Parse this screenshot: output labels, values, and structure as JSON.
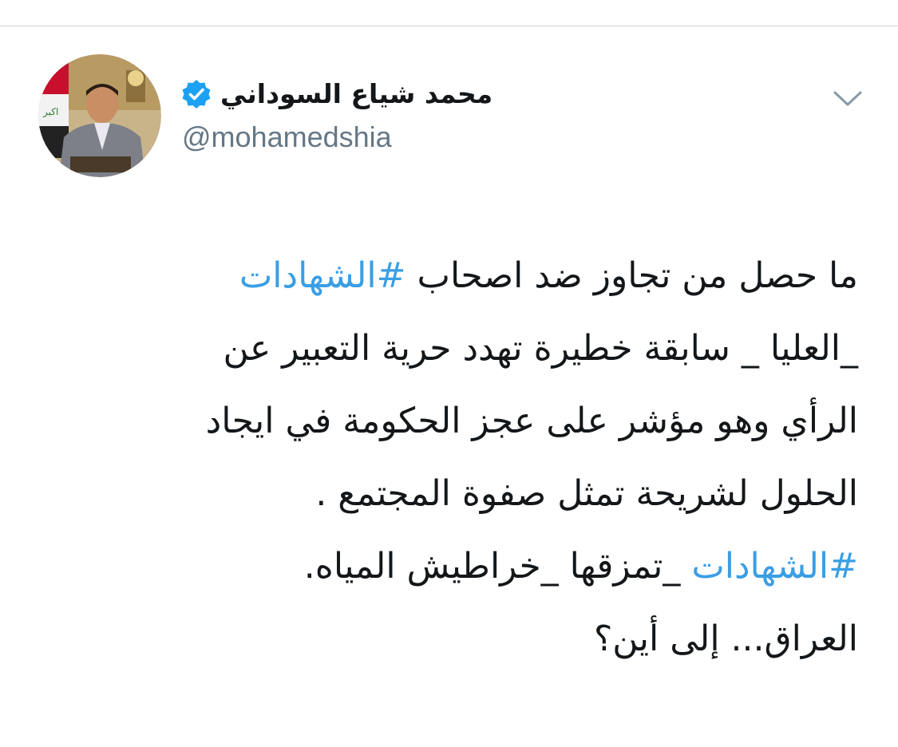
{
  "tweet": {
    "author": {
      "display_name": "محمد شياع السوداني",
      "handle": "@mohamedshia",
      "verified": true,
      "avatar_icon": "profile-photo-icon"
    },
    "menu_icon": "chevron-down-icon",
    "body_lines": [
      {
        "parts": [
          {
            "text": "ما حصل  من تجاوز ضد اصحاب ",
            "type": "text"
          },
          {
            "text": "#الشهادات",
            "type": "hashtag"
          }
        ]
      },
      {
        "parts": [
          {
            "text": "_العليا _ سابقة خطيرة تهدد حرية التعبير عن",
            "type": "text"
          }
        ]
      },
      {
        "parts": [
          {
            "text": "الرأي وهو مؤشر على عجز الحكومة في ايجاد",
            "type": "text"
          }
        ]
      },
      {
        "parts": [
          {
            "text": "الحلول لشريحة تمثل صفوة المجتمع .",
            "type": "text"
          }
        ]
      },
      {
        "parts": [
          {
            "text": "#الشهادات",
            "type": "hashtag"
          },
          {
            "text": " _تمزقها _خراطيش المياه.",
            "type": "text"
          }
        ]
      },
      {
        "parts": [
          {
            "text": "العراق... إلى أين؟",
            "type": "text"
          }
        ]
      }
    ]
  },
  "colors": {
    "hashtag": "#3a9ee5",
    "text": "#14171a",
    "handle": "#657786",
    "verified": "#1da1f2",
    "divider": "#d0d3d6"
  }
}
